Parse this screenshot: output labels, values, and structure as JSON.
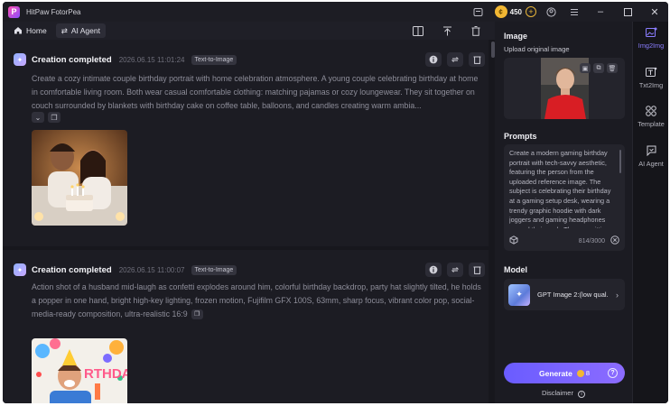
{
  "app": {
    "title": "HitPaw FotorPea",
    "credits": "450"
  },
  "nav": {
    "home": "Home",
    "agent": "AI Agent"
  },
  "cards": [
    {
      "title": "Creation completed",
      "time": "2026.06.15  11:01:24",
      "badge": "Text-to-Image",
      "prompt": "Create a cozy intimate couple birthday portrait with home celebration atmosphere. A young couple celebrating birthday at home in comfortable living room. Both wear casual comfortable clothing: matching pajamas or cozy loungewear. They sit together on couch surrounded by blankets with birthday cake on coffee table, balloons, and candles creating warm ambia..."
    },
    {
      "title": "Creation completed",
      "time": "2026.06.15  11:00:07",
      "badge": "Text-to-Image",
      "prompt": "Action shot of a husband mid-laugh as confetti explodes around him, colorful birthday backdrop, party hat slightly tilted, he holds a popper in one hand, bright high-key lighting, frozen motion, Fujifilm GFX 100S, 63mm, sharp focus, vibrant color pop, social-media-ready composition, ultra-realistic 16:9",
      "thumb_text": "RTHDA"
    }
  ],
  "panel": {
    "image_title": "Image",
    "upload_label": "Upload original image",
    "prompts_title": "Prompts",
    "prompt_text": "Create a modern gaming birthday portrait with tech-savvy aesthetic, featuring the person from the uploaded reference image. The subject is celebrating their birthday at a gaming setup desk, wearing a trendy graphic hoodie with dark joggers and gaming headphones around their neck. They are sitting",
    "prompt_count": "814/3000",
    "model_title": "Model",
    "model_name": "GPT Image 2:(low qual...",
    "generate_label": "Generate",
    "generate_cost": "8",
    "disclaimer": "Disclaimer"
  },
  "sidetabs": [
    {
      "label": "Img2Img",
      "icon": "image-edit-icon",
      "active": true
    },
    {
      "label": "Txt2Img",
      "icon": "text-image-icon",
      "active": false
    },
    {
      "label": "Template",
      "icon": "template-icon",
      "active": false
    },
    {
      "label": "AI Agent",
      "icon": "agent-icon",
      "active": false
    }
  ],
  "colors": {
    "accent": "#7b6cff",
    "background": "#17171d",
    "panel": "#1b1b22"
  }
}
